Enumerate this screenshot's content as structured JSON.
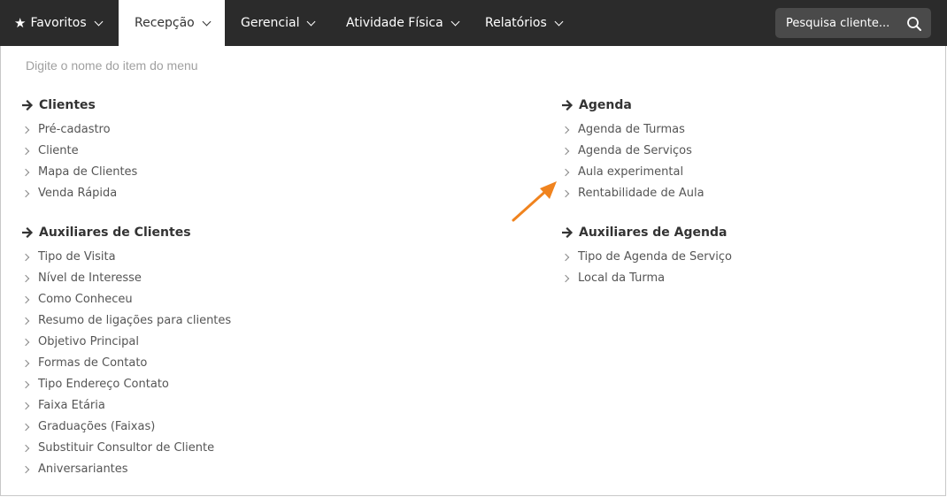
{
  "navbar": {
    "items": [
      {
        "label": "Favoritos",
        "icon": "star-icon",
        "active": false
      },
      {
        "label": "Recepção",
        "active": true
      },
      {
        "label": "Gerencial",
        "active": false
      },
      {
        "label": "Atividade Física",
        "active": false
      },
      {
        "label": "Relatórios",
        "active": false
      }
    ],
    "search": {
      "placeholder": "Pesquisa cliente..."
    }
  },
  "menu": {
    "filter_placeholder": "Digite o nome do item do menu",
    "sections": [
      {
        "title": "Clientes",
        "items": [
          "Pré-cadastro",
          "Cliente",
          "Mapa de Clientes",
          "Venda Rápida"
        ]
      },
      {
        "title": "Auxiliares de Clientes",
        "items": [
          "Tipo de Visita",
          "Nível de Interesse",
          "Como Conheceu",
          "Resumo de ligações para clientes",
          "Objetivo Principal",
          "Formas de Contato",
          "Tipo Endereço Contato",
          "Faixa Etária",
          "Graduações (Faixas)",
          "Substituir Consultor de Cliente",
          "Aniversariantes"
        ]
      },
      {
        "title": "Agenda",
        "items": [
          "Agenda de Turmas",
          "Agenda de Serviços",
          "Aula experimental",
          "Rentabilidade de Aula"
        ]
      },
      {
        "title": "Auxiliares de Agenda",
        "items": [
          "Tipo de Agenda de Serviço",
          "Local da Turma"
        ]
      }
    ]
  },
  "colors": {
    "navbar_bg": "#2b2b2b",
    "annotation_arrow": "#f0831e"
  }
}
